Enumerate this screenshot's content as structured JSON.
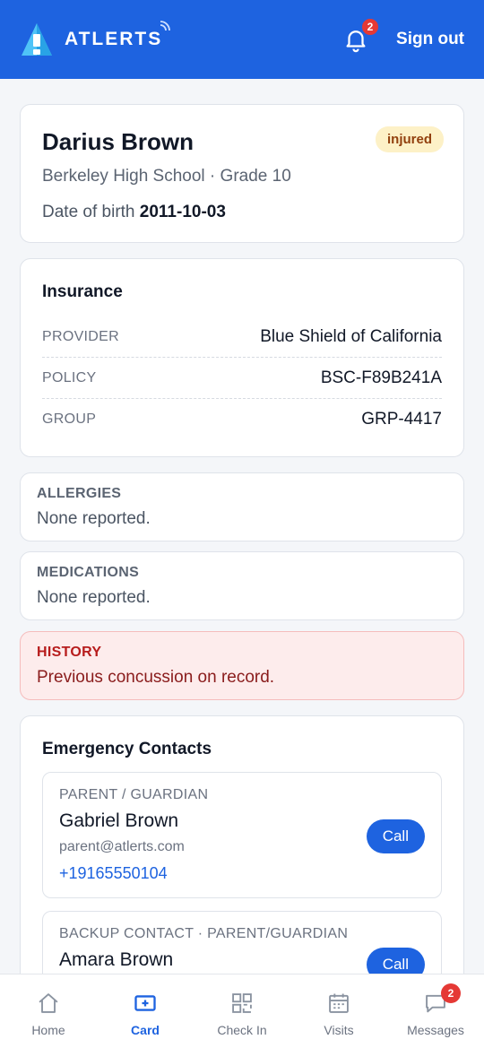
{
  "header": {
    "brand": "ATLERTS",
    "notification_count": "2",
    "signout_label": "Sign out",
    "color": "#1e63e0"
  },
  "profile": {
    "name": "Darius Brown",
    "status": "injured",
    "school_grade": "Berkeley High School · Grade 10",
    "dob_label": "Date of birth",
    "dob_value": "2011-10-03"
  },
  "insurance": {
    "title": "Insurance",
    "rows": [
      {
        "label": "PROVIDER",
        "value": "Blue Shield of California"
      },
      {
        "label": "POLICY",
        "value": "BSC-F89B241A"
      },
      {
        "label": "GROUP",
        "value": "GRP-4417"
      }
    ]
  },
  "allergies": {
    "title": "ALLERGIES",
    "text": "None reported."
  },
  "medications": {
    "title": "MEDICATIONS",
    "text": "None reported."
  },
  "history": {
    "title": "HISTORY",
    "text": "Previous concussion on record."
  },
  "contacts": {
    "title": "Emergency Contacts",
    "items": [
      {
        "role": "PARENT / GUARDIAN",
        "name": "Gabriel Brown",
        "email": "parent@atlerts.com",
        "phone": "+19165550104",
        "call_label": "Call"
      },
      {
        "role": "BACKUP CONTACT · PARENT/GUARDIAN",
        "name": "Amara Brown",
        "call_label": "Call"
      }
    ]
  },
  "nav": {
    "items": [
      {
        "label": "Home",
        "icon": "home-icon"
      },
      {
        "label": "Card",
        "icon": "card-icon"
      },
      {
        "label": "Check In",
        "icon": "qr-code-icon"
      },
      {
        "label": "Visits",
        "icon": "calendar-icon"
      },
      {
        "label": "Messages",
        "icon": "message-icon",
        "badge": "2"
      }
    ],
    "active": "Card"
  }
}
